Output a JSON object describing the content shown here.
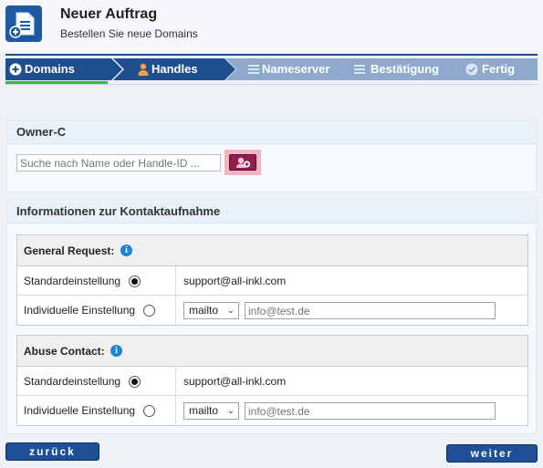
{
  "header": {
    "title": "Neuer Auftrag",
    "subtitle": "Bestellen Sie neue Domains",
    "icon": "document-add-icon"
  },
  "steps": [
    {
      "label": "Domains",
      "icon": "plus-circle-icon",
      "state": "done"
    },
    {
      "label": "Handles",
      "icon": "person-icon",
      "state": "active"
    },
    {
      "label": "Nameserver",
      "icon": "list-icon",
      "state": "pending"
    },
    {
      "label": "Bestätigung",
      "icon": "list-icon",
      "state": "pending"
    },
    {
      "label": "Fertig",
      "icon": "check-circle-icon",
      "state": "pending"
    }
  ],
  "owner": {
    "heading": "Owner-C",
    "search_placeholder": "Suche nach Name oder Handle-ID ...",
    "search_value": ""
  },
  "contact": {
    "heading": "Informationen zur Kontaktaufnahme",
    "general": {
      "title": "General Request:",
      "default_label": "Standardeinstellung",
      "default_value": "support@all-inkl.com",
      "custom_label": "Individuelle Einstellung",
      "select_value": "mailto",
      "email_placeholder": "info@test.de"
    },
    "abuse": {
      "title": "Abuse Contact:",
      "default_label": "Standardeinstellung",
      "default_value": "support@all-inkl.com",
      "custom_label": "Individuelle Einstellung",
      "select_value": "mailto",
      "email_placeholder": "info@test.de"
    }
  },
  "nav": {
    "back_label": "zurück",
    "next_label": "weiter"
  },
  "colors": {
    "brand": "#1d5aa0",
    "step_dark": "#1f4f8f",
    "step_light": "#8ea9cc",
    "done_underline": "#3fb34f",
    "add_button": "#8c1f4e"
  }
}
